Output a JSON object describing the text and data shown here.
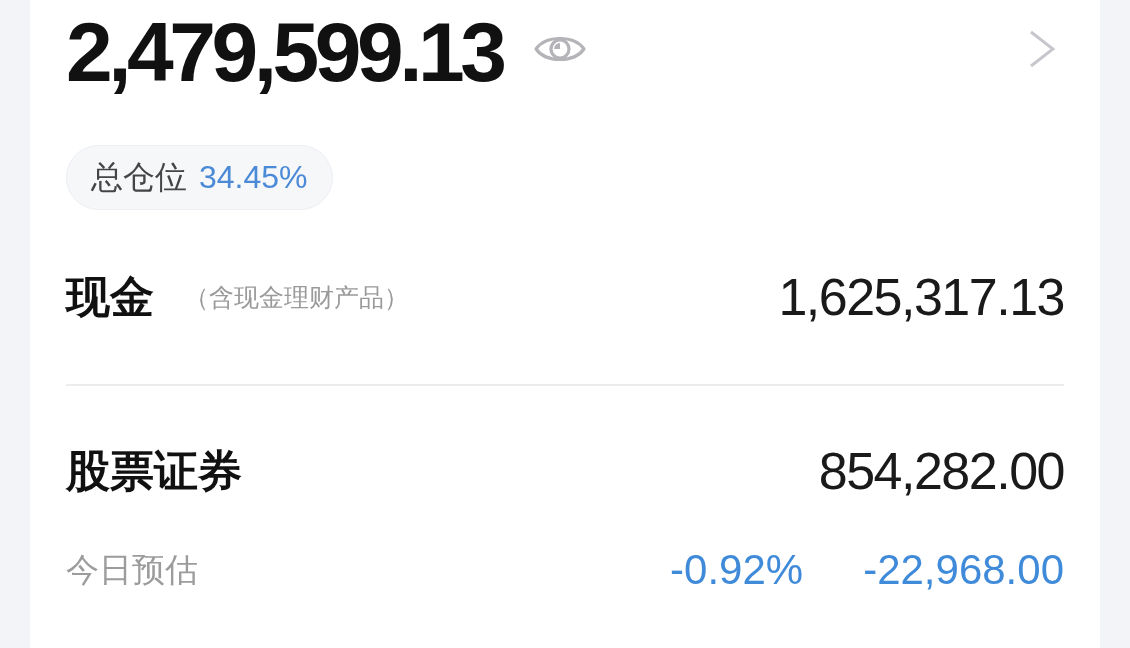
{
  "total_assets": {
    "amount": "2,479,599.13"
  },
  "position": {
    "label": "总仓位",
    "value": "34.45%"
  },
  "sections": [
    {
      "label": "现金",
      "note": "（含现金理财产品）",
      "amount": "1,625,317.13"
    },
    {
      "label": "股票证券",
      "amount": "854,282.00",
      "today": {
        "label": "今日预估",
        "percent": "-0.92%",
        "change": "-22,968.00"
      }
    }
  ]
}
